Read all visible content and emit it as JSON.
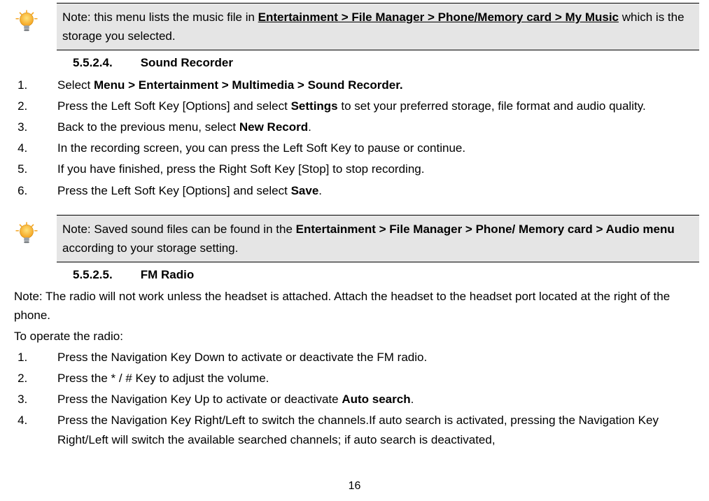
{
  "note1": {
    "pre": "Note: this menu lists the music file in ",
    "bold": "Entertainment > File Manager > Phone/Memory card > My Music",
    "post": " which is the storage you selected."
  },
  "heading1": {
    "num": "5.5.2.4.",
    "title": "Sound Recorder"
  },
  "steps1": {
    "s1a": "Select ",
    "s1b": "Menu > Entertainment > Multimedia > Sound Recorder.",
    "s2a": "Press the Left Soft Key [Options] and select ",
    "s2b": "Settings",
    "s2c": " to set your preferred storage, file format and audio quality.",
    "s3a": "Back to the previous menu, select ",
    "s3b": "New Record",
    "s3c": ".",
    "s4": "In the recording screen, you can press the Left Soft Key to pause or continue.",
    "s5": "If you have finished, press the Right Soft Key [Stop] to stop recording.",
    "s6a": "Press the Left Soft Key [Options] and select ",
    "s6b": "Save",
    "s6c": "."
  },
  "note2": {
    "pre": "Note: Saved sound files can be found in the ",
    "bold": "Entertainment > File Manager > Phone/ Memory card > Audio menu",
    "post": " according to your storage setting."
  },
  "heading2": {
    "num": "5.5.2.5.",
    "title": "FM Radio"
  },
  "fm_intro1": "Note: The radio will not work unless the headset is attached. Attach the headset to the headset port located at the right of the phone.",
  "fm_intro2": "To operate the radio:",
  "steps2": {
    "s1": "Press the Navigation Key Down to activate or deactivate the FM radio.",
    "s2": "Press the * / # Key to adjust the volume.",
    "s3a": "Press the Navigation Key Up to activate or deactivate ",
    "s3b": "Auto search",
    "s3c": ".",
    "s4": "Press the Navigation Key Right/Left to switch the channels.If auto search is activated, pressing the Navigation Key Right/Left will switch the available searched channels; if auto search is deactivated,"
  },
  "page_number": "16"
}
